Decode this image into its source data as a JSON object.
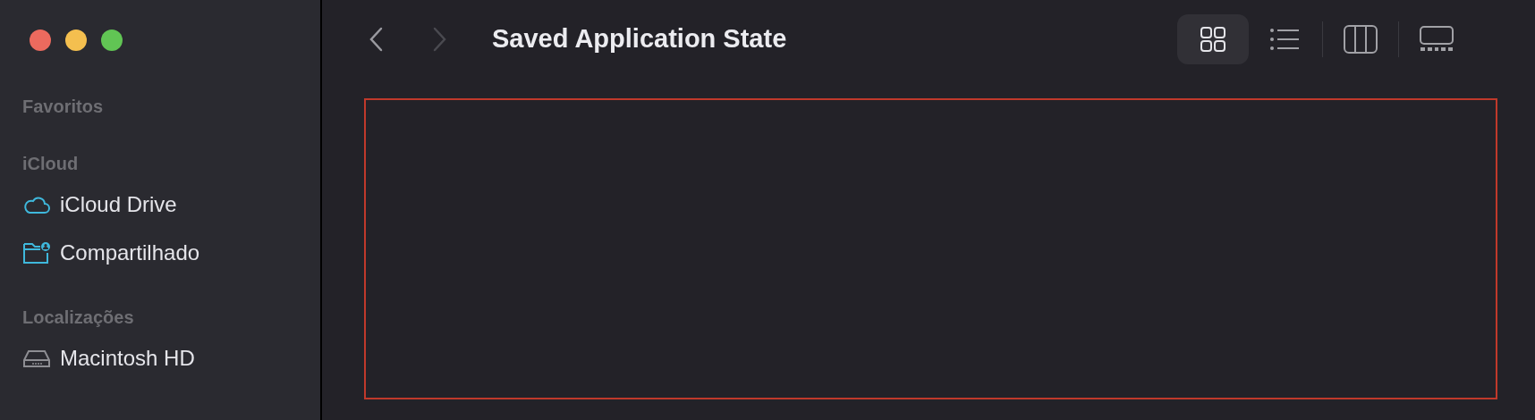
{
  "sidebar": {
    "sections": [
      {
        "title": "Favoritos"
      },
      {
        "title": "iCloud",
        "items": [
          {
            "label": "iCloud Drive",
            "kind": "cloud"
          },
          {
            "label": "Compartilhado",
            "kind": "shared-folder"
          }
        ]
      },
      {
        "title": "Localizações",
        "items": [
          {
            "label": "Macintosh HD",
            "kind": "disk"
          }
        ]
      }
    ]
  },
  "toolbar": {
    "back": {
      "disabled": false
    },
    "forward": {
      "disabled": true
    },
    "title": "Saved Application State",
    "views": [
      {
        "kind": "icons",
        "selected": true
      },
      {
        "kind": "list",
        "selected": false
      },
      {
        "kind": "columns",
        "selected": false
      },
      {
        "kind": "gallery",
        "selected": false
      }
    ]
  }
}
